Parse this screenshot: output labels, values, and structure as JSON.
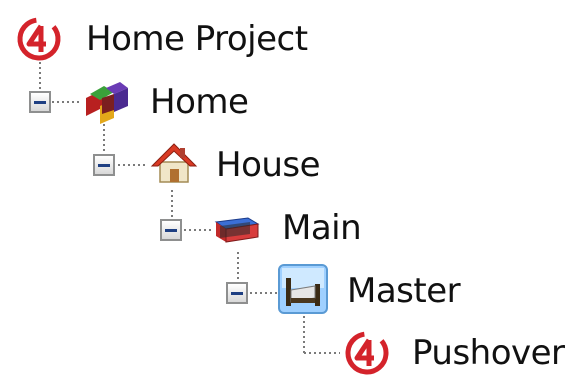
{
  "tree": {
    "nodes": [
      {
        "label": "Home Project",
        "icon": "control4-logo-icon",
        "expanded": true
      },
      {
        "label": "Home",
        "icon": "colored-blocks-icon",
        "expanded": true
      },
      {
        "label": "House",
        "icon": "house-icon",
        "expanded": true
      },
      {
        "label": "Main",
        "icon": "floor-icon",
        "expanded": true
      },
      {
        "label": "Master",
        "icon": "room-bed-icon",
        "expanded": true
      },
      {
        "label": "Pushover",
        "icon": "control4-logo-icon",
        "expanded": false
      }
    ],
    "colors": {
      "logo_red": "#d4232b",
      "toggle_minus": "#1e3f82",
      "connector": "#7a7a7a"
    }
  }
}
